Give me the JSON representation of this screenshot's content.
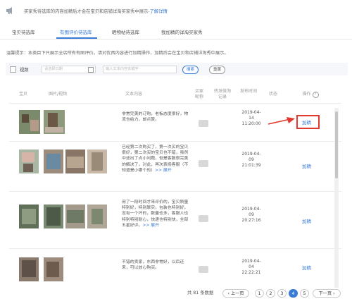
{
  "notice": {
    "text": "买家秀待选库的内容加精后才会在宝贝和店铺详淘买家秀中展示-",
    "link": "了解详情"
  },
  "tabs": [
    {
      "label": "宝贝待选库"
    },
    {
      "label": "有图评价待选库"
    },
    {
      "label": "晒物帖待选库"
    },
    {
      "label": "我加精的详淘买家秀"
    }
  ],
  "hint": "温馨提示：本类目下只展示全店所有有图评价。请对优西内容进行加精操作，加精后会在宝贝和店铺详淘秀中展示。",
  "filter": {
    "video_label": "视频",
    "date_placeholder": "请选择日期",
    "keyword_placeholder": "输入文本内容关键字",
    "search_label": "搜索",
    "reset_label": "重置"
  },
  "table": {
    "headers": {
      "product": "宝贝",
      "media": "图片/视频",
      "content": "文本内容",
      "nick": "买家昵称",
      "forwarded": "转发微淘记录",
      "time": "发布时间",
      "status": "状态",
      "action": "操作"
    },
    "rows": [
      {
        "text": "非常完美的订购，老板态度很好，物流也给力，邮点赞。",
        "expand": "",
        "date": "2019-04-14 11:20:00",
        "action": "加精"
      },
      {
        "text": "已经第二次购买了，第一次买的宝贝很好，第二次买的宝贝也不错，虽然中途出了点小问题，但是客服很完美的解决了，对此，再次表扬客服（不知道是小哪个的）",
        "expand": ">> 展开",
        "date": "2019-04-09 21:01:39",
        "action": "加精"
      },
      {
        "text": "用了一段时间才来评价的，宝贝质量特别好，特别厚实，包装也特别好，没有一个坏的，数量也多，客服人也特别特别耐心，快递也特别快，全部五星好评。",
        "expand": ">> 展开",
        "date": "2019-04-09 20:27:16",
        "action": "加精"
      },
      {
        "text": "不错的卖家，东西非常好，以后还来，可以放心购买。",
        "expand": "",
        "date": "2019-04-04 22:22:21",
        "action": "加精"
      }
    ]
  },
  "pagination": {
    "total": "共 81 条数据",
    "prev": "上一页",
    "pages": [
      "1",
      "2",
      "3",
      "4",
      "5"
    ],
    "current": "4",
    "next": "下一页"
  },
  "colors": {
    "accent": "#3a7bd5",
    "highlight": "#e03a30"
  }
}
